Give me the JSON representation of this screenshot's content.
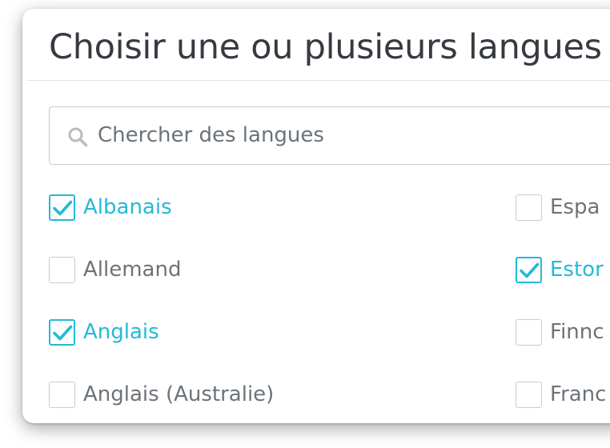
{
  "modal": {
    "title": "Choisir une ou plusieurs langues"
  },
  "search": {
    "placeholder": "Chercher des langues",
    "icon": "search-icon"
  },
  "colors": {
    "accent": "#25b9d7",
    "text": "#363a41",
    "muted": "#6c7379",
    "border": "#c7cdd3"
  },
  "languages": [
    {
      "label": "Albanais",
      "checked": true
    },
    {
      "label": "Allemand",
      "checked": false
    },
    {
      "label": "Anglais",
      "checked": true
    },
    {
      "label": "Anglais (Australie)",
      "checked": false
    },
    {
      "label": "Espa",
      "checked": false
    },
    {
      "label": "Estor",
      "checked": true
    },
    {
      "label": "Finnc",
      "checked": false
    },
    {
      "label": "Franc",
      "checked": false
    }
  ]
}
